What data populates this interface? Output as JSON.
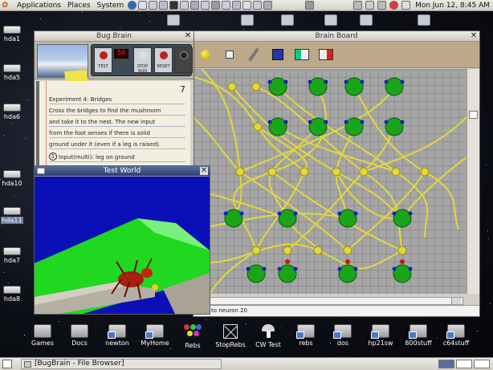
{
  "top_panel": {
    "menus": [
      "Applications",
      "Places",
      "System"
    ],
    "clock": "Mon Jun 12,  8:45 AM"
  },
  "desktop_icons": [
    "hda1",
    "hda5",
    "hda6",
    "hda10",
    "hda11",
    "hda7",
    "hda8"
  ],
  "bug_brain": {
    "title": "Bug Brain",
    "buttons": {
      "test": "TEST",
      "display": "50",
      "stop_run": "STOP RUN",
      "reset": "RESET"
    },
    "page_number": "7",
    "lines": [
      "Experiment 4: Bridges",
      "Cross the bridges to find the mushroom",
      "and take it to the nest. The new input",
      "from the foot senses if there is solid",
      "ground under it (even if a leg is raised).",
      "Input(multi): leg on ground"
    ]
  },
  "brain_board": {
    "title": "Brain Board",
    "status": "to neuron 20"
  },
  "test_world": {
    "title": "Test World"
  },
  "bottom_icons": [
    "Games",
    "Docs",
    "newton",
    "MyHome",
    "Rebs",
    "StopRebs",
    "CW Test",
    "rebs",
    "dos",
    "hp21sw",
    "800stuff",
    "c64stuff"
  ],
  "bottom_panel": {
    "task": "[BugBrain - File Browser]"
  },
  "colors": {
    "neuron": "#19a419",
    "wire": "#e3d83a",
    "board_bg": "#a6a6a6",
    "ground": "#1fd81f",
    "sky": "#0b0fb8"
  }
}
